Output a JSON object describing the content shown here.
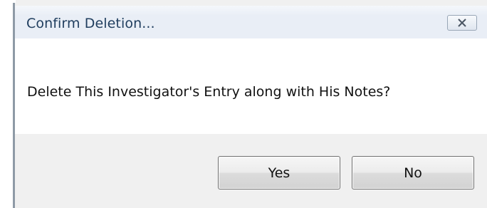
{
  "dialog": {
    "title": "Confirm Deletion...",
    "message": "Delete This Investigator's Entry along with His Notes?",
    "close_icon": "close-icon",
    "buttons": {
      "yes_label": "Yes",
      "no_label": "No"
    }
  },
  "colors": {
    "title_text": "#1f3d5e",
    "titlebar_bg": "#e9eef6",
    "content_bg": "#ffffff",
    "button_area_bg": "#f0f0f0"
  }
}
